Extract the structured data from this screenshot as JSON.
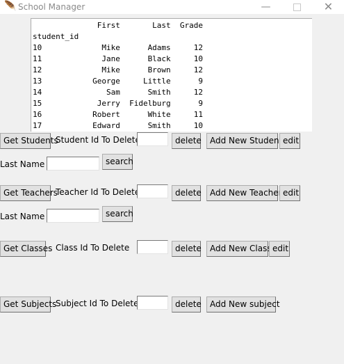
{
  "window": {
    "title": "School Manager",
    "icon": "feather-icon",
    "controls": {
      "minimize": "—",
      "close": "✕"
    }
  },
  "students_table": {
    "text": "              First       Last  Grade\nstudent_id                            \n10             Mike      Adams     12\n11             Jane      Black     10\n12             Mike      Brown     12\n13           George     Little      9\n14              Sam      Smith     12\n15            Jerry  Fidelburg      9\n16           Robert      White     11\n17           Edward      Smith     10"
  },
  "students": {
    "get_label": "Get Students",
    "delete_prompt": "Student Id To Delete",
    "delete_label": "delete",
    "add_label": "Add New Student",
    "edit_label": "edit",
    "search_field_label": "Last Name",
    "search_label": "search"
  },
  "teachers": {
    "get_label": "Get Teachers",
    "delete_prompt": "Teacher Id To Delete",
    "delete_label": "delete",
    "add_label": "Add New Teacher",
    "edit_label": "edit",
    "search_field_label": "Last Name",
    "search_label": "search"
  },
  "classes": {
    "get_label": "Get Classes",
    "delete_prompt": "Class Id To Delete",
    "delete_label": "delete",
    "add_label": "Add New Class",
    "edit_label": "edit"
  },
  "subjects": {
    "get_label": "Get Subjects",
    "delete_prompt": "Subject Id To Delete",
    "delete_label": "delete",
    "add_label": "Add New subject"
  }
}
